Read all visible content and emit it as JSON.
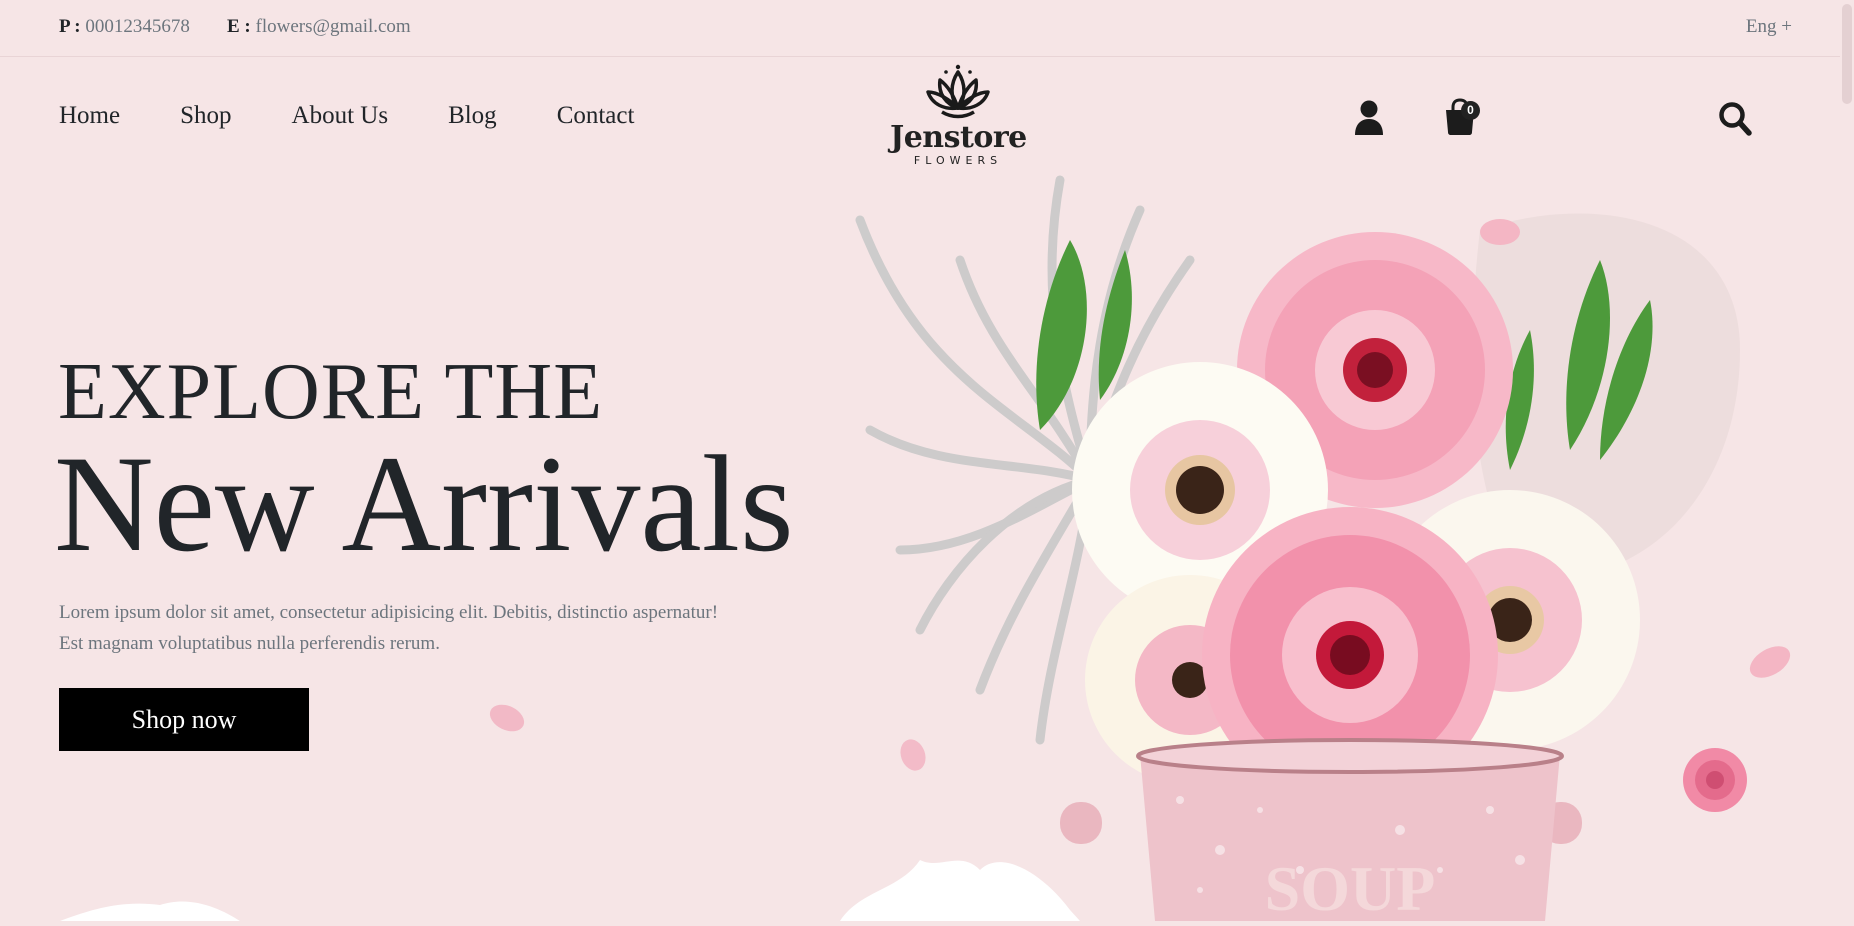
{
  "topbar": {
    "phone_label": "P :",
    "phone": "00012345678",
    "email_label": "E :",
    "email": "flowers@gmail.com",
    "language": "Eng +"
  },
  "nav": {
    "items": [
      "Home",
      "Shop",
      "About Us",
      "Blog",
      "Contact"
    ]
  },
  "logo": {
    "name": "Jenstore",
    "tagline": "FLOWERS"
  },
  "header_icons": {
    "user": "user-icon",
    "cart": "cart-icon",
    "cart_count": "0",
    "search": "search-icon"
  },
  "hero": {
    "pretitle": "EXPLORE THE",
    "title": "New Arrivals",
    "description_line1": "Lorem ipsum dolor sit amet, consectetur adipisicing elit. Debitis, distinctio aspernatur!",
    "description_line2": "Est magnam voluptatibus nulla perferendis rerum.",
    "cta": "Shop now"
  },
  "illustration": {
    "pot_text": "SOUP"
  },
  "colors": {
    "background": "#f6e5e6",
    "text": "#212529",
    "muted": "#6c757d",
    "button": "#000000",
    "flower_pink": "#f5a9bd",
    "flower_center": "#b5142f"
  }
}
